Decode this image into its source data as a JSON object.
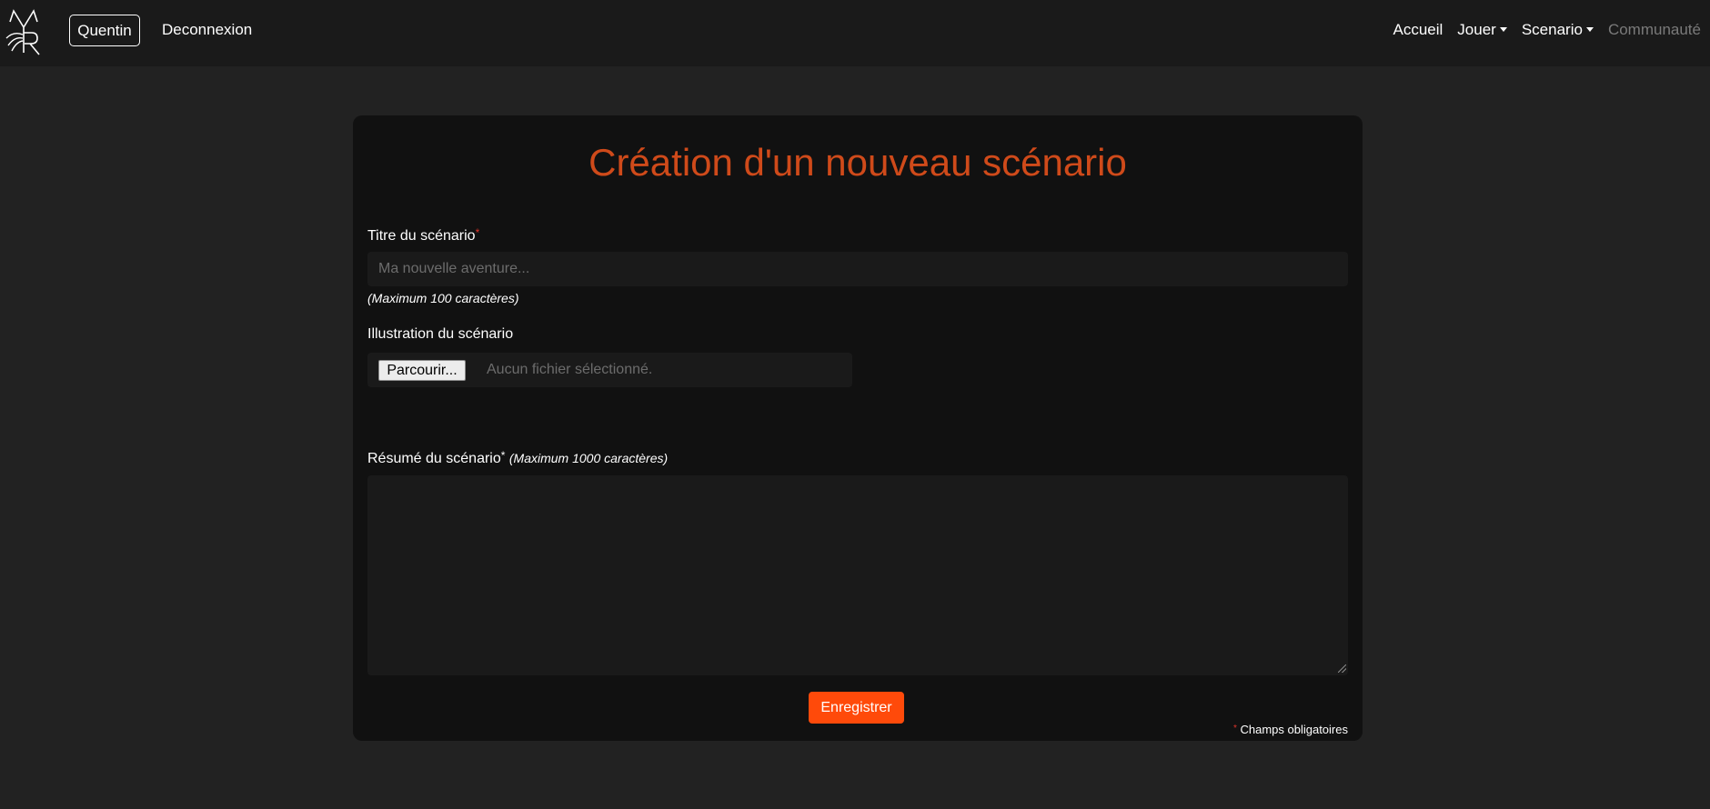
{
  "navbar": {
    "user_label": "Quentin",
    "logout_label": "Deconnexion",
    "links": {
      "home": "Accueil",
      "play": "Jouer",
      "scenario": "Scenario",
      "community": "Communauté"
    }
  },
  "form": {
    "title": "Création d'un nouveau scénario",
    "scenario_title": {
      "label": "Titre du scénario",
      "required_mark": "*",
      "placeholder": "Ma nouvelle aventure...",
      "hint": "(Maximum 100 caractères)",
      "value": ""
    },
    "illustration": {
      "label": "Illustration du scénario",
      "button_label": "Parcourir...",
      "status": "Aucun fichier sélectionné."
    },
    "summary": {
      "label": "Résumé du scénario",
      "required_mark": "*",
      "hint": "(Maximum 1000 caractères)",
      "value": ""
    },
    "submit_label": "Enregistrer",
    "footnote_mark": "*",
    "footnote_text": "Champs obligatoires"
  },
  "colors": {
    "accent": "#ff4a0a",
    "title": "#cf4a1a",
    "required": "#e0352b"
  }
}
